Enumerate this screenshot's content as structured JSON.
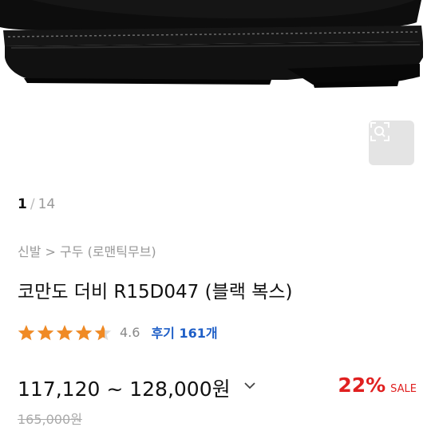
{
  "gallery": {
    "current": "1",
    "separator": "/",
    "total": "14"
  },
  "breadcrumb": {
    "category": "신발",
    "separator": ">",
    "subcategory": "구두 (로맨틱무브)"
  },
  "product": {
    "title": "코만도 더비 R15D047 (블랙 복스)",
    "rating": 4.6,
    "rating_text": "4.6",
    "review_text": "후기 161개",
    "price_range": "117,120 ~ 128,000원",
    "discount": "22%",
    "sale_label": "SALE",
    "original_price": "165,000원"
  },
  "colors": {
    "accent": "#e02020",
    "star": "#f08a24",
    "link": "#1f5fc7"
  },
  "icons": {
    "zoom": "search-zoom-icon",
    "chevron": "chevron-down-icon",
    "star": "star-icon"
  }
}
